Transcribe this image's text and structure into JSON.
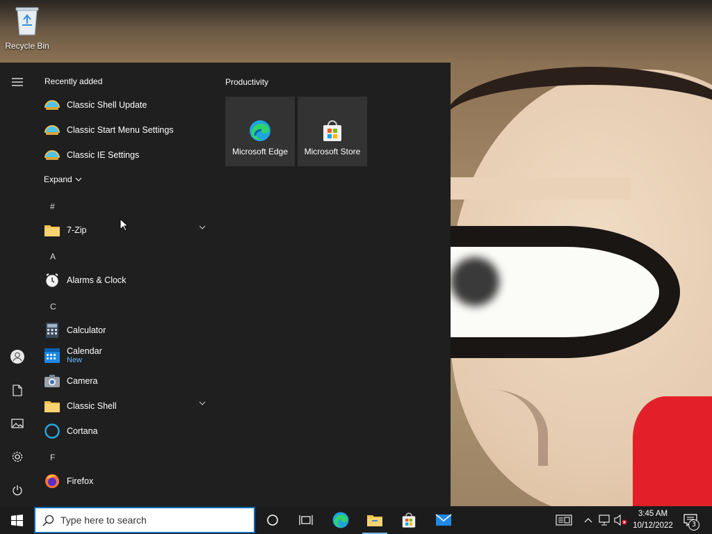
{
  "desktop": {
    "recycle_bin_label": "Recycle Bin"
  },
  "start_menu": {
    "recently_added_heading": "Recently added",
    "recent_items": [
      {
        "name": "Classic Shell Update",
        "icon": "classic-shell-icon"
      },
      {
        "name": "Classic Start Menu Settings",
        "icon": "classic-shell-icon"
      },
      {
        "name": "Classic IE Settings",
        "icon": "classic-shell-icon"
      }
    ],
    "expand_label": "Expand",
    "letters": {
      "hash": "#",
      "a": "A",
      "c": "C",
      "f": "F"
    },
    "apps": {
      "seven_zip": {
        "name": "7-Zip",
        "icon": "folder-icon"
      },
      "alarms": {
        "name": "Alarms & Clock",
        "icon": "alarm-clock-icon"
      },
      "calculator": {
        "name": "Calculator",
        "icon": "calculator-icon"
      },
      "calendar": {
        "name": "Calendar",
        "sub": "New",
        "icon": "calendar-icon"
      },
      "camera": {
        "name": "Camera",
        "icon": "camera-icon"
      },
      "classic_shell": {
        "name": "Classic Shell",
        "icon": "folder-icon"
      },
      "cortana": {
        "name": "Cortana",
        "icon": "cortana-icon"
      },
      "firefox": {
        "name": "Firefox",
        "icon": "firefox-icon"
      }
    },
    "tiles_group_title": "Productivity",
    "tiles": [
      {
        "label": "Microsoft Edge",
        "icon": "edge-icon"
      },
      {
        "label": "Microsoft Store",
        "icon": "store-icon"
      }
    ]
  },
  "taskbar": {
    "search_placeholder": "Type here to search",
    "clock_time": "3:45 AM",
    "clock_date": "10/12/2022",
    "notification_count": "3"
  },
  "colors": {
    "start_bg": "#1f1f1f",
    "tile_bg": "#333333",
    "taskbar_bg": "#1c1c1c",
    "accent": "#76b9ed",
    "new_badge": "#6cb8ff"
  }
}
